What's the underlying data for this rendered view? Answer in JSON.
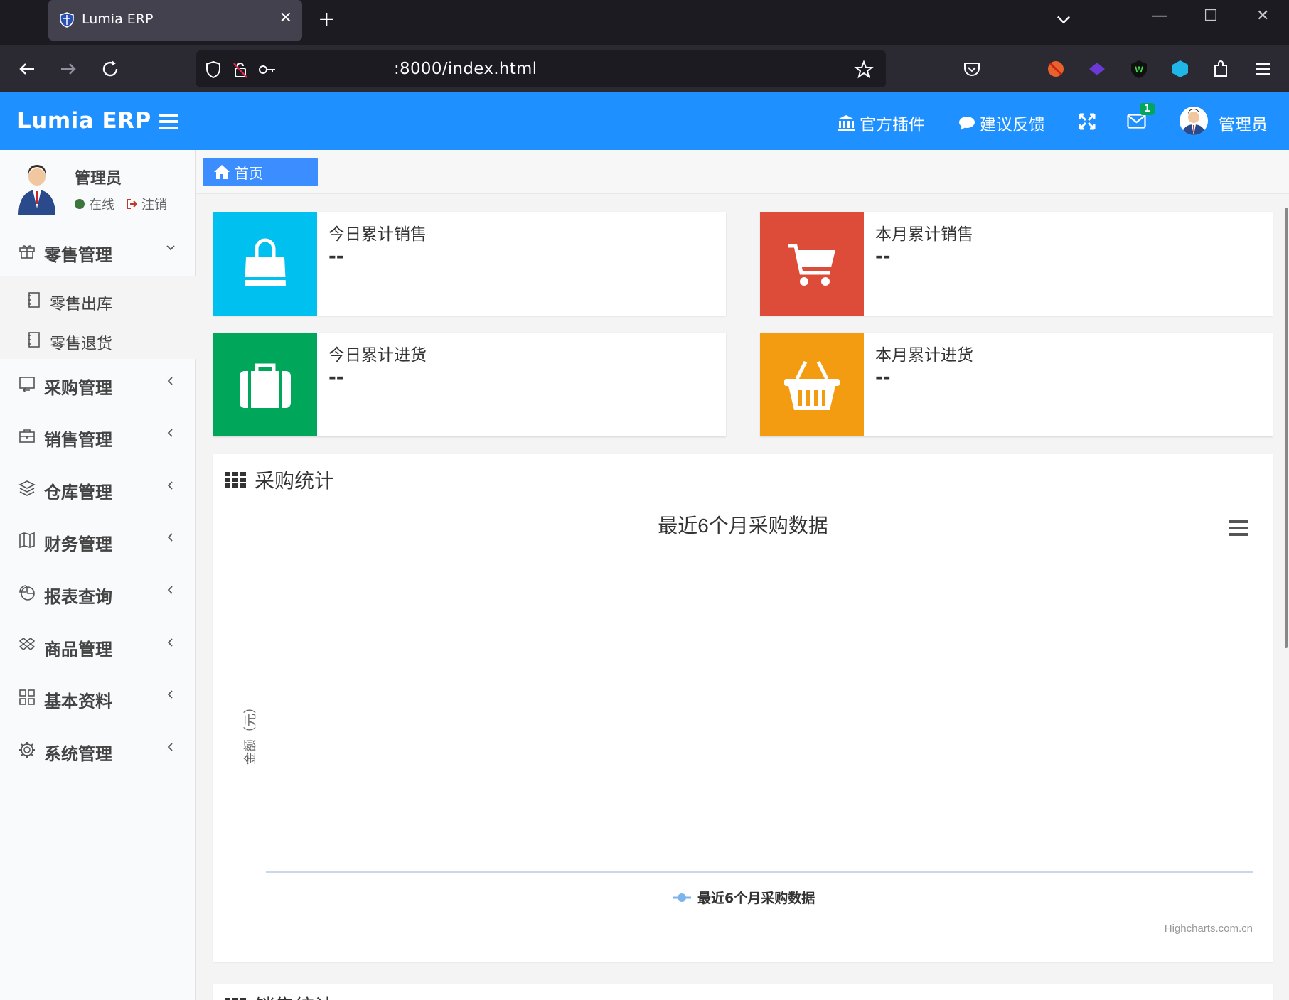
{
  "browser": {
    "tab_title": "Lumia ERP",
    "url": ":8000/index.html"
  },
  "header": {
    "logo": "Lumia ERP",
    "plugins_label": "官方插件",
    "feedback_label": "建议反馈",
    "mail_badge": "1",
    "user_name": "管理员"
  },
  "sidebar": {
    "user": {
      "name": "管理员",
      "status": "在线",
      "logout": "注销"
    },
    "menu": [
      {
        "label": "零售管理",
        "icon": "gift-icon",
        "expanded": true
      },
      {
        "label": "采购管理",
        "icon": "return-icon"
      },
      {
        "label": "销售管理",
        "icon": "briefcase-icon"
      },
      {
        "label": "仓库管理",
        "icon": "layers-icon"
      },
      {
        "label": "财务管理",
        "icon": "book-icon"
      },
      {
        "label": "报表查询",
        "icon": "pie-chart-icon"
      },
      {
        "label": "商品管理",
        "icon": "dropbox-icon"
      },
      {
        "label": "基本资料",
        "icon": "grid-icon"
      },
      {
        "label": "系统管理",
        "icon": "gear-icon"
      }
    ],
    "submenu": [
      {
        "label": "零售出库",
        "icon": "notebook-icon"
      },
      {
        "label": "零售退货",
        "icon": "notebook-icon"
      }
    ]
  },
  "breadcrumb": {
    "home": "首页"
  },
  "infoboxes": [
    {
      "label": "今日累计销售",
      "value": "--",
      "color": "#00c0ef",
      "icon": "shopping-bag-icon"
    },
    {
      "label": "本月累计销售",
      "value": "--",
      "color": "#dd4b39",
      "icon": "shopping-cart-icon"
    },
    {
      "label": "今日累计进货",
      "value": "--",
      "color": "#00a65a",
      "icon": "suitcase-icon"
    },
    {
      "label": "本月累计进货",
      "value": "--",
      "color": "#f39c12",
      "icon": "basket-icon"
    }
  ],
  "purchase_stats": {
    "title": "采购统计",
    "chart_data": {
      "type": "line",
      "title": "最近6个月采购数据",
      "ylabel": "金额（元）",
      "series": [
        {
          "name": "最近6个月采购数据",
          "values": []
        }
      ],
      "legend": "bottom-center",
      "credits": "Highcharts.com.cn"
    }
  },
  "sales_stats": {
    "title": "销售统计"
  },
  "colors": {
    "header": "#1e90ff",
    "accent": "#3c8dff"
  }
}
